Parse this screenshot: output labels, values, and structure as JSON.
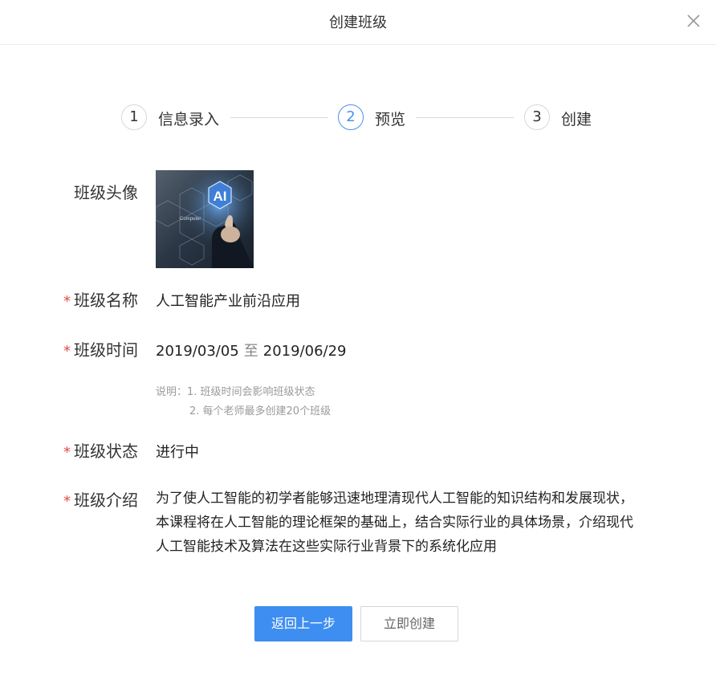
{
  "dialog": {
    "title": "创建班级",
    "close_label": "×"
  },
  "steps": [
    {
      "number": "1",
      "label": "信息录入",
      "active": false
    },
    {
      "number": "2",
      "label": "预览",
      "active": true
    },
    {
      "number": "3",
      "label": "创建",
      "active": false
    }
  ],
  "form": {
    "required_mark": "*",
    "avatar": {
      "label": "班级头像",
      "image_text": "AI",
      "image_caption": "Computer"
    },
    "name": {
      "label": "班级名称",
      "value": "人工智能产业前沿应用"
    },
    "time": {
      "label": "班级时间",
      "start": "2019/03/05",
      "separator": "至",
      "end": "2019/06/29",
      "note_line1": "说明：1. 班级时间会影响班级状态",
      "note_line2": "2. 每个老师最多创建20个班级"
    },
    "status": {
      "label": "班级状态",
      "value": "进行中"
    },
    "intro": {
      "label": "班级介绍",
      "lines": [
        "为了使人工智能的初学者能够迅速地理清现代人工智能的知识结构和发展现状，",
        "本课程将在人工智能的理论框架的基础上，结合实际行业的具体场景，介绍现代",
        "人工智能技术及算法在这些实际行业背景下的系统化应用"
      ]
    }
  },
  "actions": {
    "back_label": "返回上一步",
    "create_label": "立即创建"
  },
  "colors": {
    "primary": "#3d8ef0",
    "active_step": "#4a8ff0",
    "required": "#e24a4a"
  }
}
